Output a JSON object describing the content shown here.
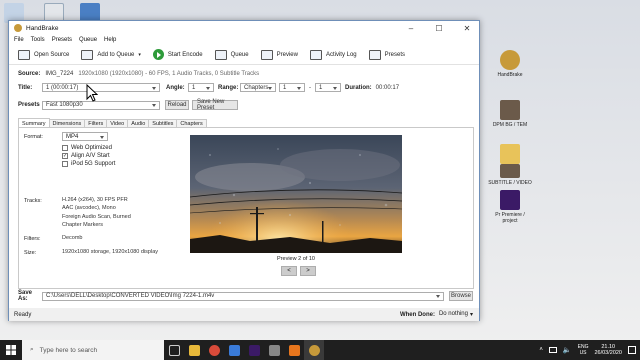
{
  "window": {
    "title": "HandBrake",
    "menu": [
      "File",
      "Tools",
      "Presets",
      "Queue",
      "Help"
    ],
    "toolbar": {
      "open_source": "Open Source",
      "add_to_queue": "Add to Queue",
      "start_encode": "Start Encode",
      "queue": "Queue",
      "preview": "Preview",
      "activity_log": "Activity Log",
      "presets": "Presets"
    }
  },
  "source": {
    "label": "Source:",
    "name": "IMG_7224",
    "info": "1920x1080 (1920x1080) - 60 FPS, 1 Audio Tracks, 0 Subtitle Tracks"
  },
  "title_row": {
    "title_label": "Title:",
    "title_value": "1 (00:00:17)",
    "angle_label": "Angle:",
    "angle_value": "1",
    "range_label": "Range:",
    "range_type": "Chapters",
    "range_start": "1",
    "range_sep": "-",
    "range_end": "1",
    "duration_label": "Duration:",
    "duration_value": "00:00:17"
  },
  "presets_row": {
    "label": "Presets",
    "value": "Fast 1080p30",
    "reload": "Reload",
    "save_new": "Save New Preset"
  },
  "tabs": [
    "Summary",
    "Dimensions",
    "Filters",
    "Video",
    "Audio",
    "Subtitles",
    "Chapters"
  ],
  "summary": {
    "format_label": "Format:",
    "format_value": "MP4",
    "options": [
      {
        "label": "Web Optimized",
        "checked": false
      },
      {
        "label": "Align A/V Start",
        "checked": true
      },
      {
        "label": "iPod 5G Support",
        "checked": false
      }
    ],
    "tracks_label": "Tracks:",
    "tracks": [
      "H.264 (x264), 30 FPS PFR",
      "AAC (avcodec), Mono",
      "Foreign Audio Scan, Burned",
      "Chapter Markers"
    ],
    "filters_label": "Filters:",
    "filters_value": "Decomb",
    "size_label": "Size:",
    "size_value": "1920x1080 storage, 1920x1080 display",
    "preview_caption": "Preview 2 of 10",
    "prev_symbol": "<",
    "next_symbol": ">"
  },
  "save_as": {
    "label": "Save As:",
    "path": "C:\\Users\\DELL\\Desktop\\CONVERTED VIDEO\\Img 7224-1.m4v",
    "browse": "Browse"
  },
  "status": {
    "text": "Ready",
    "when_done_label": "When Done:",
    "when_done_value": "Do nothing"
  },
  "desktop_icons": [
    {
      "label": "HandBrake",
      "color": "#c79a3a"
    },
    {
      "label": "DPM BG / TEM",
      "color": "#6b5a4a"
    },
    {
      "label": "",
      "color": "#e8c35a"
    },
    {
      "label": "SUBTITLE / VIDEO",
      "color": "#6b5a4a"
    },
    {
      "label": "Pr Premiere / project",
      "color": "#3b1a66"
    }
  ],
  "taskbar": {
    "search_placeholder": "Type here to search",
    "lang": "ENG",
    "region": "US",
    "time": "21.10",
    "date": "26/03/2020"
  },
  "colors": {
    "accent": "#2e9b3a",
    "window_border": "#6f8fb8",
    "taskbar": "#1f1f1f"
  }
}
